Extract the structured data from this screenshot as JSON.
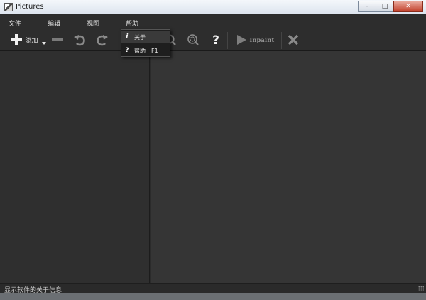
{
  "window": {
    "title": "Pictures"
  },
  "caption_buttons": {
    "minimize": "–",
    "maximize": "□",
    "close": "✕"
  },
  "menubar": {
    "items": [
      {
        "id": "file",
        "label": "文件"
      },
      {
        "id": "edit",
        "label": "编辑"
      },
      {
        "id": "view",
        "label": "视图"
      },
      {
        "id": "help",
        "label": "帮助"
      }
    ]
  },
  "toolbar": {
    "add_label": "添加",
    "inpaint_label": "Inpaint",
    "icons": [
      "plus-icon",
      "minus-icon",
      "undo-icon",
      "redo-icon",
      "zoom-in-icon",
      "zoom-fit-icon",
      "help-icon",
      "play-icon",
      "close-x-icon"
    ]
  },
  "help_menu": {
    "items": [
      {
        "icon_text": "i",
        "label": "关于",
        "shortcut": ""
      },
      {
        "icon_text": "?",
        "label": "帮助",
        "shortcut": "F1"
      }
    ]
  },
  "statusbar": {
    "text": "显示软件的关于信息"
  },
  "colors": {
    "background": "#2b2b2b",
    "canvas": "#353535",
    "panel": "#2f2f2f"
  }
}
